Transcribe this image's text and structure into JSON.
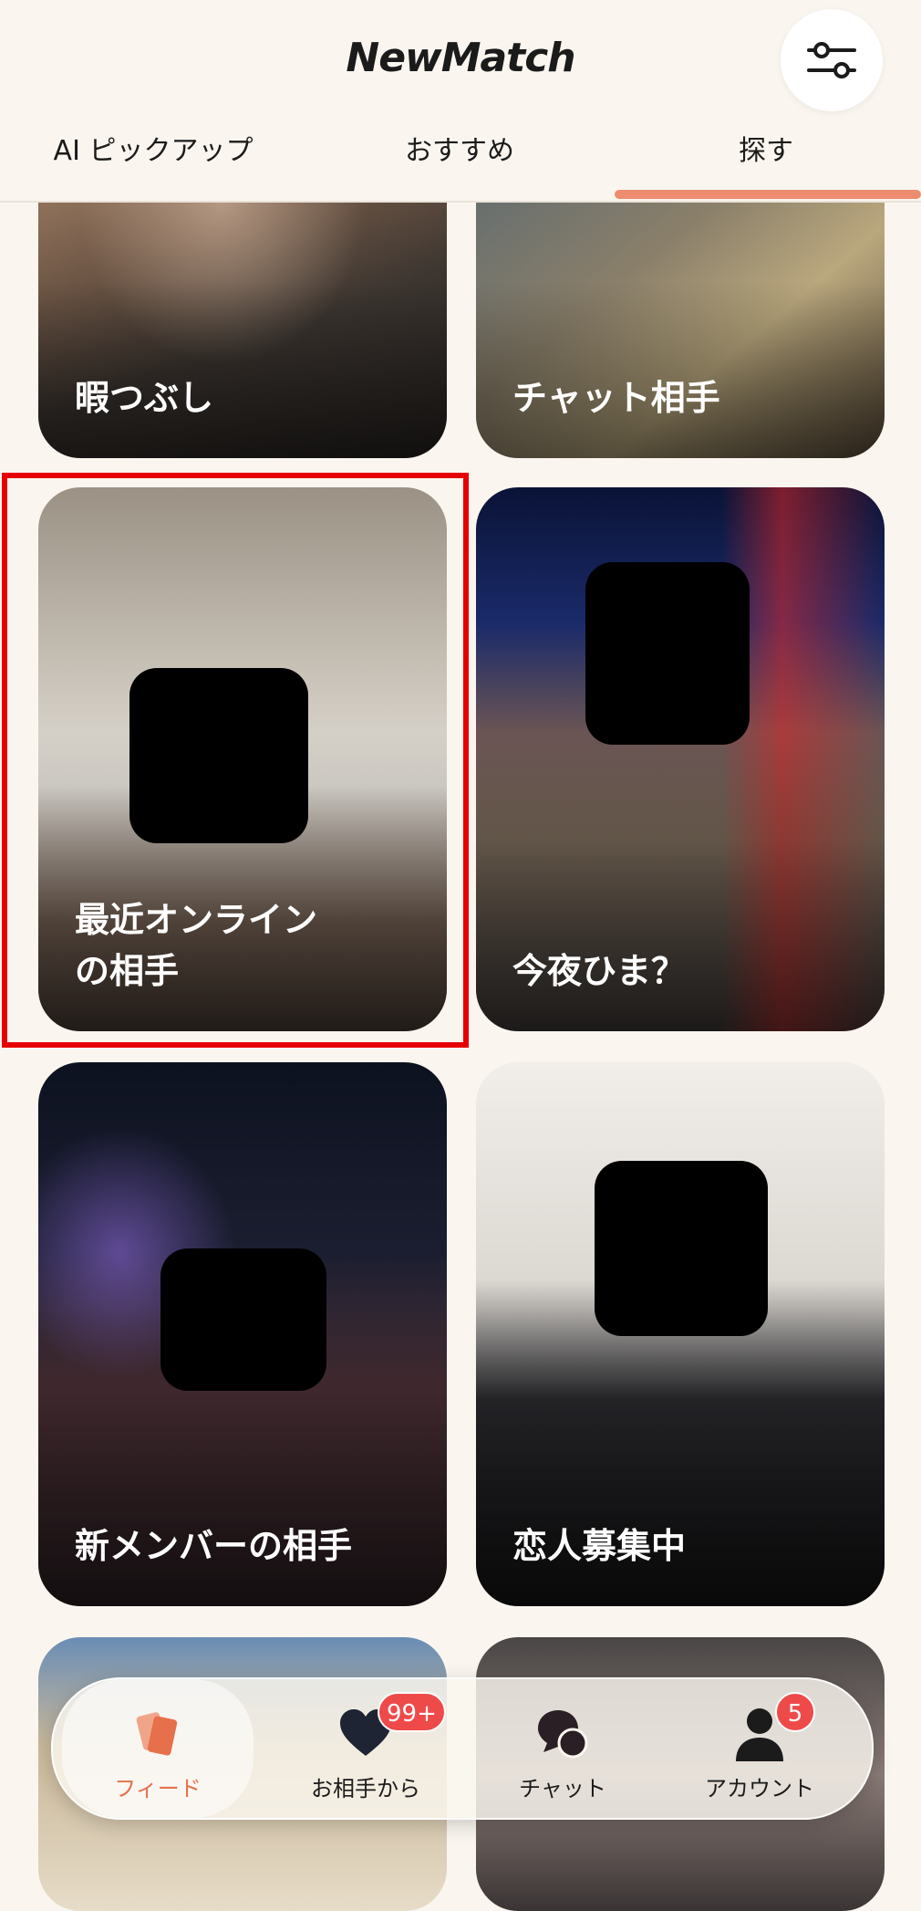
{
  "app": {
    "title": "NewMatch"
  },
  "tabs": [
    {
      "label": "AI ピックアップ"
    },
    {
      "label": "おすすめ"
    },
    {
      "label": "探す",
      "active": true
    }
  ],
  "cards": [
    {
      "label": "暇つぶし"
    },
    {
      "label": "チャット相手"
    },
    {
      "label": "最近オンライン\nの相手",
      "highlighted": true
    },
    {
      "label": "今夜ひま？"
    },
    {
      "label": "新メンバーの相手"
    },
    {
      "label": "恋人募集中"
    }
  ],
  "bottom_nav": [
    {
      "label": "フィード",
      "icon": "cards-icon",
      "active": true
    },
    {
      "label": "お相手から",
      "icon": "heart-icon",
      "badge": "99+"
    },
    {
      "label": "チャット",
      "icon": "chat-bubbles-icon"
    },
    {
      "label": "アカウント",
      "icon": "person-icon",
      "badge": "5"
    }
  ],
  "colors": {
    "accent": "#ee8c70",
    "badge": "#ef4a4a",
    "background": "#faf6ef",
    "highlight": "#e60000"
  }
}
